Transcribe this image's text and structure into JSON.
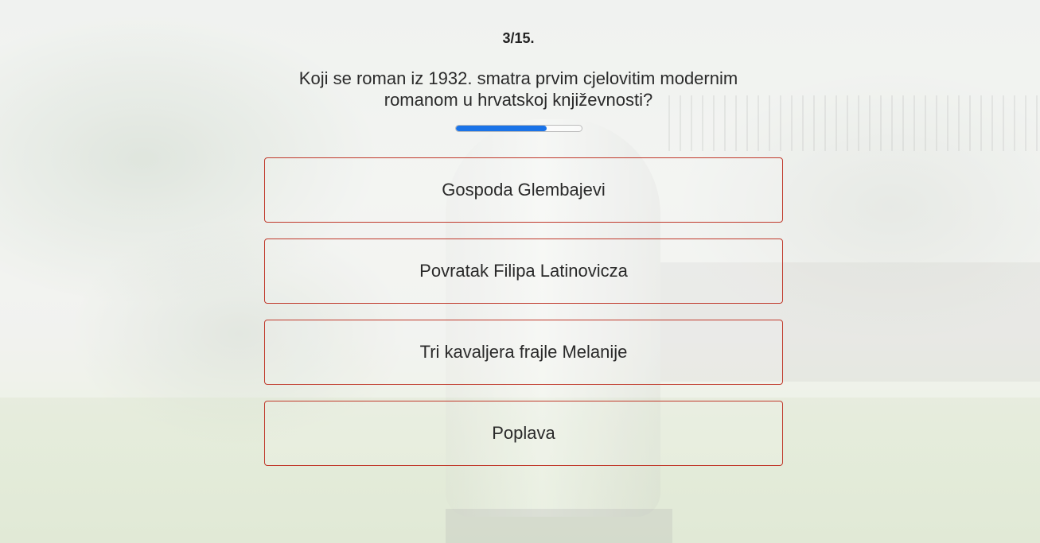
{
  "quiz": {
    "counter": "3/15.",
    "question": "Koji se roman iz 1932. smatra prvim cjelovitim modernim romanom u hrvatskoj književnosti?",
    "progress_fraction": 0.72,
    "progress_color": "#1a73e8",
    "answer_border_color": "#c0392b",
    "answers": [
      {
        "label": "Gospoda Glembajevi"
      },
      {
        "label": "Povratak Filipa Latinovicza"
      },
      {
        "label": "Tri kavaljera frajle Melanije"
      },
      {
        "label": "Poplava"
      }
    ]
  }
}
